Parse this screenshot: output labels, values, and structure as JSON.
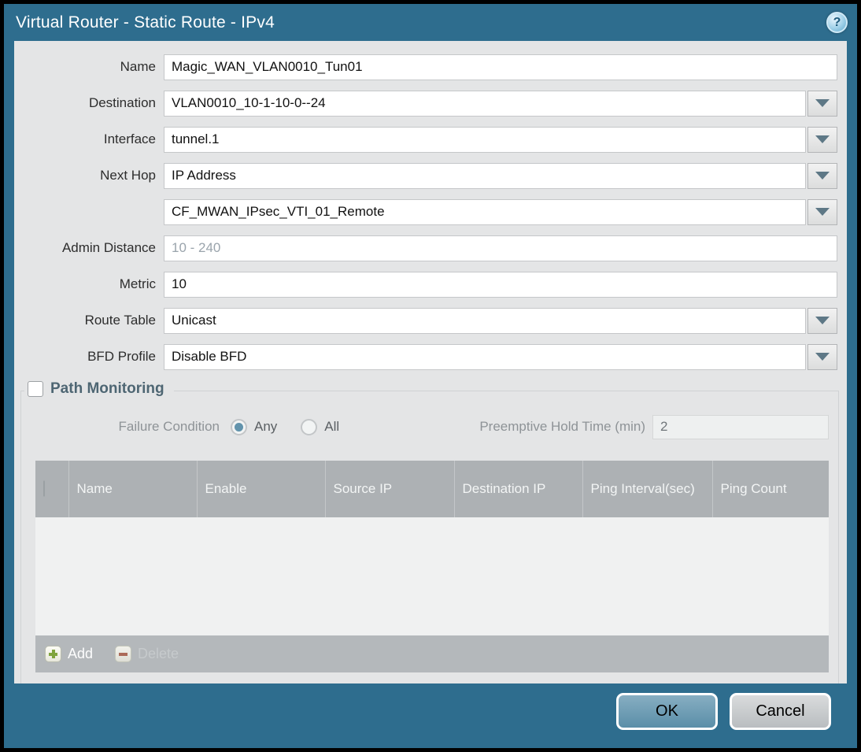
{
  "window": {
    "title": "Virtual Router - Static Route - IPv4",
    "help_icon": "?"
  },
  "form": {
    "name": {
      "label": "Name",
      "value": "Magic_WAN_VLAN0010_Tun01"
    },
    "destination": {
      "label": "Destination",
      "value": "VLAN0010_10-1-10-0--24"
    },
    "interface": {
      "label": "Interface",
      "value": "tunnel.1"
    },
    "next_hop": {
      "label": "Next Hop",
      "value": "IP Address"
    },
    "next_hop_address": {
      "value": "CF_MWAN_IPsec_VTI_01_Remote"
    },
    "admin_distance": {
      "label": "Admin Distance",
      "placeholder": "10 - 240",
      "value": ""
    },
    "metric": {
      "label": "Metric",
      "value": "10"
    },
    "route_table": {
      "label": "Route Table",
      "value": "Unicast"
    },
    "bfd_profile": {
      "label": "BFD Profile",
      "value": "Disable BFD"
    }
  },
  "path_monitoring": {
    "title": "Path Monitoring",
    "checked": false,
    "failure_condition": {
      "label": "Failure Condition",
      "options": [
        "Any",
        "All"
      ],
      "selected": "Any"
    },
    "preemptive_hold_time": {
      "label": "Preemptive Hold Time (min)",
      "value": "2"
    },
    "table": {
      "columns": [
        "Name",
        "Enable",
        "Source IP",
        "Destination IP",
        "Ping Interval(sec)",
        "Ping Count"
      ],
      "rows": []
    },
    "add_label": "Add",
    "delete_label": "Delete"
  },
  "footer": {
    "ok_label": "OK",
    "cancel_label": "Cancel"
  },
  "colors": {
    "titlebar": "#2e6d8e",
    "panel": "#e4e5e6",
    "table_header": "#adb1b4",
    "ok_button": "#6f9cb4",
    "add_icon_green": "#80a43e",
    "delete_icon_red": "#ab6a58",
    "radio_selected": "#6293ac"
  }
}
